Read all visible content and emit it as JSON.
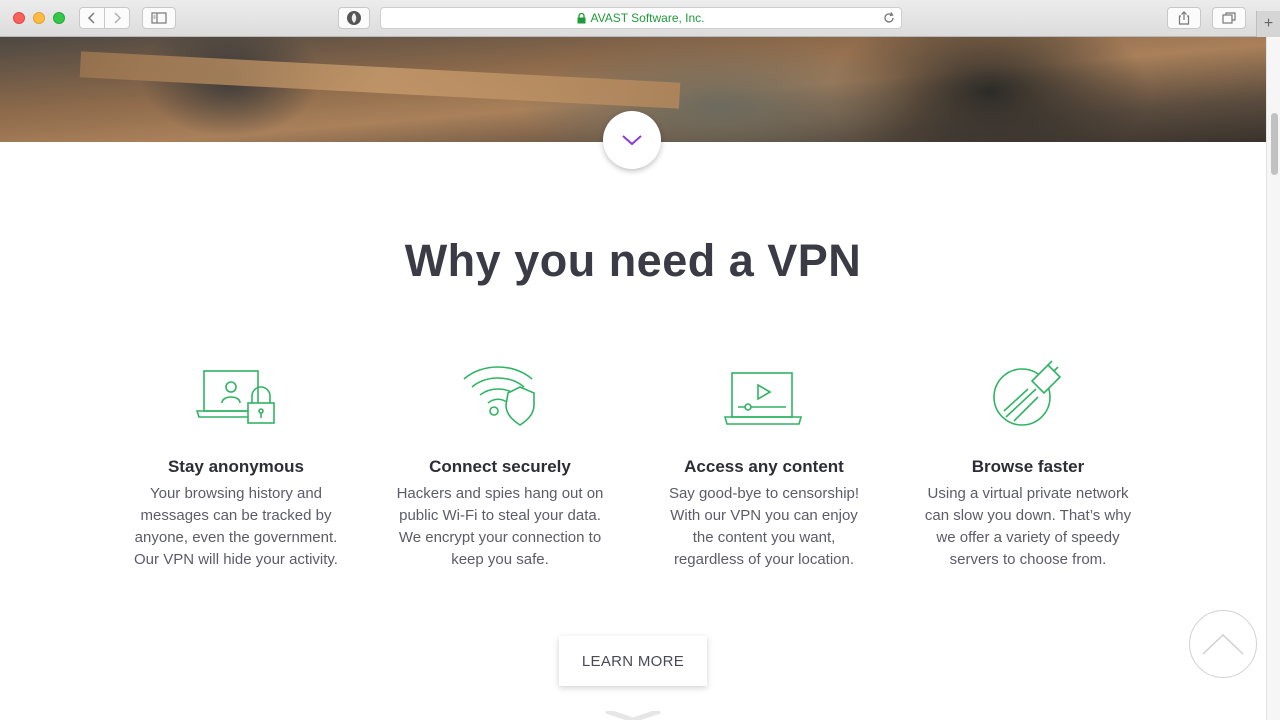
{
  "browser": {
    "url_text": "AVAST Software, Inc.",
    "secure": true
  },
  "page": {
    "title": "Why you need a VPN",
    "features": [
      {
        "heading": "Stay anonymous",
        "text": "Your browsing history and messages can be tracked by anyone, even the government. Our VPN will hide your activity.",
        "icon": "laptop-lock-icon"
      },
      {
        "heading": "Connect securely",
        "text": "Hackers and spies hang out on public Wi-Fi to steal your data. We encrypt your connection to keep you safe.",
        "icon": "wifi-shield-icon"
      },
      {
        "heading": "Access any content",
        "text": "Say good-bye to censorship! With our VPN you can enjoy the content you want, regardless of your location.",
        "icon": "laptop-play-icon"
      },
      {
        "heading": "Browse faster",
        "text": "Using a virtual private network can slow you down. That’s why we offer a variety of speedy servers to choose from.",
        "icon": "speed-plug-icon"
      }
    ],
    "learn_more_label": "LEARN MORE"
  },
  "colors": {
    "accent_green": "#2fb463",
    "title_color": "#3b3b45",
    "scroll_chevron": "#8a3bd6",
    "url_green": "#1f9a3a"
  }
}
